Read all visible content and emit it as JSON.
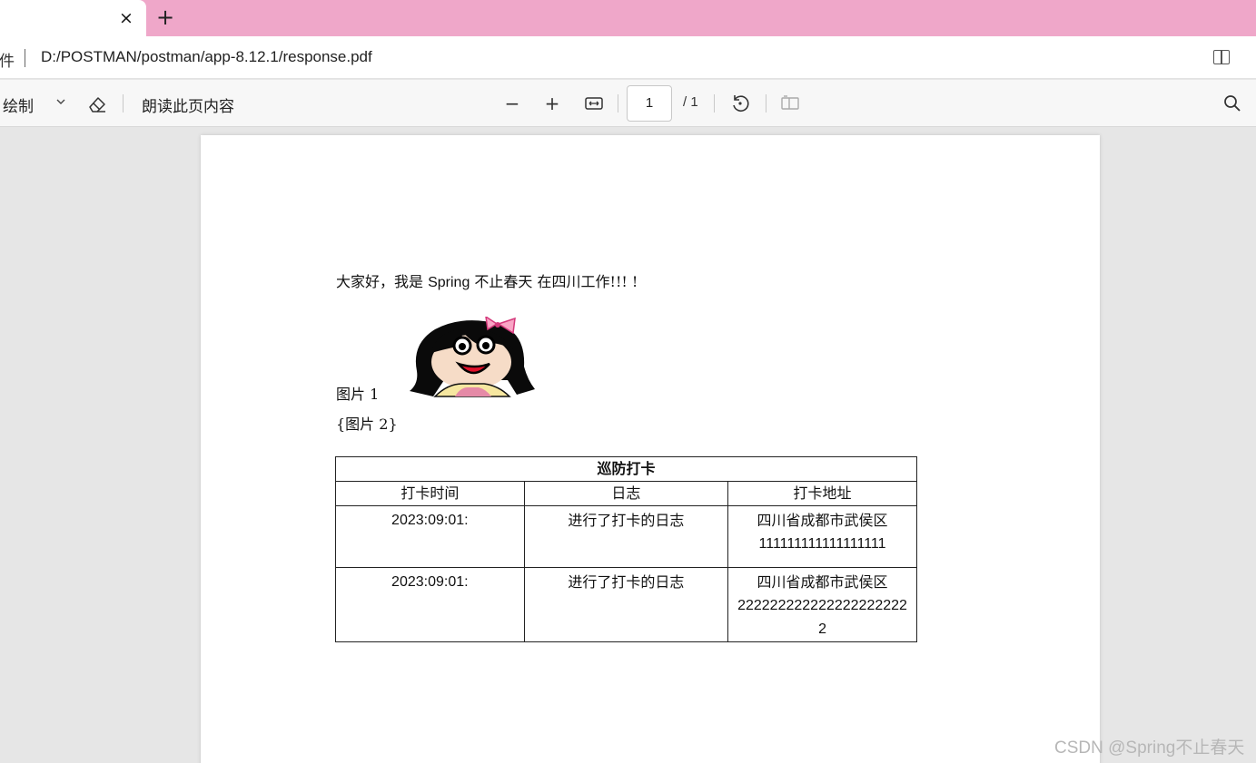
{
  "tabbar": {
    "close_glyph": "×",
    "new_tab_glyph": "+"
  },
  "address": {
    "prefix": "件",
    "url": "D:/POSTMAN/postman/app-8.12.1/response.pdf"
  },
  "toolbar": {
    "draw_label": "绘制",
    "read_aloud_label": "朗读此页内容",
    "zoom_out_glyph": "−",
    "zoom_in_glyph": "+",
    "page_current": "1",
    "page_total": "/ 1"
  },
  "document": {
    "greeting_cn_1": "大家好，我是 ",
    "greeting_latin": "Spring",
    "greeting_cn_2": " 不止春天 在四川工作!!! !",
    "image1_label": "图片 1",
    "image2_label": "{图片 2}",
    "table": {
      "caption": "巡防打卡",
      "headers": [
        "打卡时间",
        "日志",
        "打卡地址"
      ],
      "rows": [
        {
          "time": "2023:09:01:",
          "log": "进行了打卡的日志",
          "addr_cn": "四川省成都市武侯区",
          "addr_num": "111111111111111111"
        },
        {
          "time": "2023:09:01:",
          "log": "进行了打卡的日志",
          "addr_cn": "四川省成都市武侯区",
          "addr_num": "222222222222222222222",
          "addr_num_2": "2"
        }
      ]
    }
  },
  "watermark": "CSDN @Spring不止春天",
  "colors": {
    "tabstrip": "#efa7c9",
    "toolbar": "#f7f7f7",
    "canvas": "#e6e6e6"
  }
}
